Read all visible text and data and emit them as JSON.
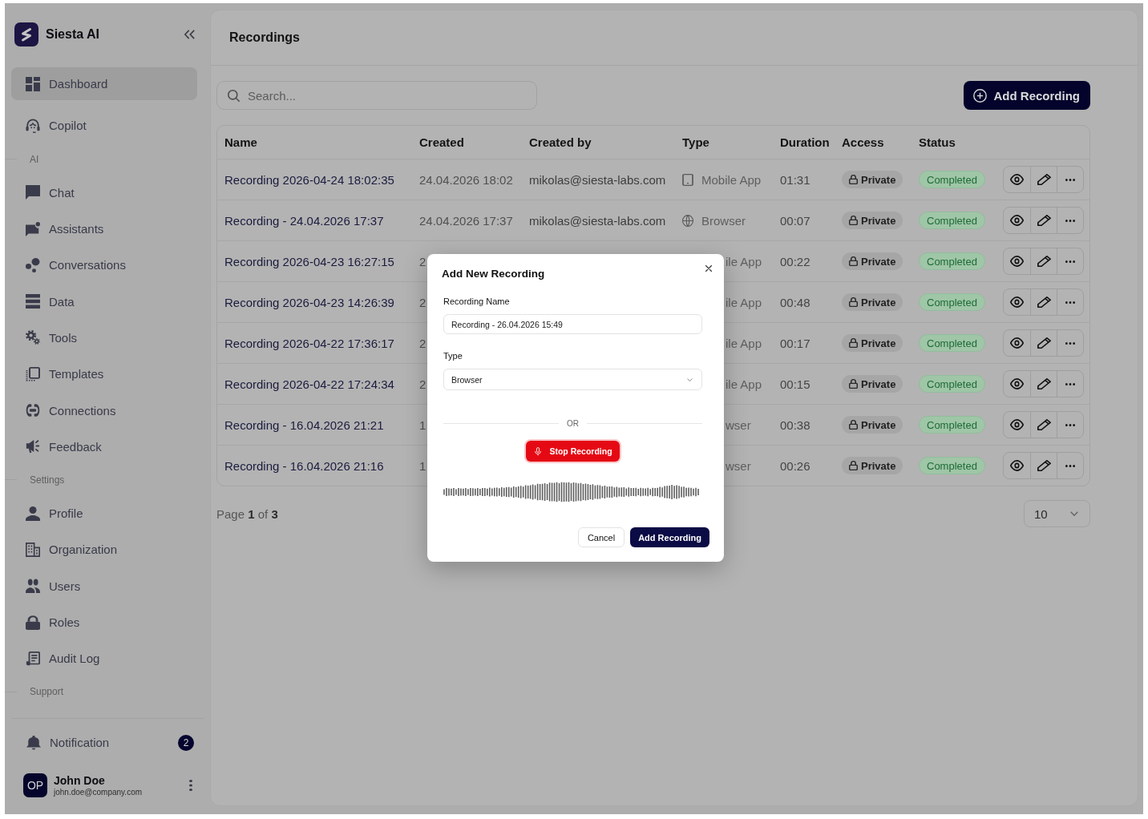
{
  "sidebar": {
    "brand": "Siesta AI",
    "nav": [
      {
        "kind": "link",
        "label": "Dashboard",
        "selected": true
      },
      {
        "kind": "link",
        "label": "Copilot",
        "selected": false
      },
      {
        "kind": "section",
        "label": "AI"
      },
      {
        "kind": "link",
        "label": "Chat",
        "selected": false
      },
      {
        "kind": "link",
        "label": "Assistants",
        "selected": false
      },
      {
        "kind": "link",
        "label": "Conversations",
        "selected": false
      },
      {
        "kind": "link",
        "label": "Data",
        "selected": false
      },
      {
        "kind": "link",
        "label": "Tools",
        "selected": false
      },
      {
        "kind": "link",
        "label": "Templates",
        "selected": false
      },
      {
        "kind": "link",
        "label": "Connections",
        "selected": false
      },
      {
        "kind": "link",
        "label": "Feedback",
        "selected": false
      },
      {
        "kind": "section",
        "label": "Settings"
      },
      {
        "kind": "link",
        "label": "Profile",
        "selected": false
      },
      {
        "kind": "link",
        "label": "Organization",
        "selected": false
      },
      {
        "kind": "link",
        "label": "Users",
        "selected": false
      },
      {
        "kind": "link",
        "label": "Roles",
        "selected": false
      },
      {
        "kind": "link",
        "label": "Audit Log",
        "selected": false
      },
      {
        "kind": "section",
        "label": "Support"
      }
    ],
    "notification": {
      "label": "Notification",
      "count": "2"
    },
    "user": {
      "initials": "OP",
      "name": "John Doe",
      "email": "john.doe@company.com"
    }
  },
  "header": {
    "title": "Recordings"
  },
  "toolbar": {
    "search": {
      "placeholder": "Search..."
    },
    "add_button": "Add Recording"
  },
  "table": {
    "columns": [
      "Name",
      "Created",
      "Created by",
      "Type",
      "Duration",
      "Access",
      "Status"
    ],
    "rows": [
      {
        "name": "Recording 2026-04-24 18:02:35",
        "created": "24.04.2026 18:02",
        "created_by": "mikolas@siesta-labs.com",
        "type": {
          "kind": "mobile",
          "label": "Mobile App"
        },
        "duration": "01:31",
        "access": "Private",
        "status": "Completed"
      },
      {
        "name": "Recording - 24.04.2026 17:37",
        "created": "24.04.2026 17:37",
        "created_by": "mikolas@siesta-labs.com",
        "type": {
          "kind": "browser",
          "label": "Browser"
        },
        "duration": "00:07",
        "access": "Private",
        "status": "Completed"
      },
      {
        "name": "Recording 2026-04-23 16:27:15",
        "created": "2",
        "type": {
          "kind": "cut",
          "label": "ile App"
        },
        "duration": "00:22",
        "access": "Private",
        "status": "Completed"
      },
      {
        "name": "Recording 2026-04-23 14:26:39",
        "created": "2",
        "type": {
          "kind": "cut",
          "label": "ile App"
        },
        "duration": "00:48",
        "access": "Private",
        "status": "Completed"
      },
      {
        "name": "Recording 2026-04-22 17:36:17",
        "created": "2",
        "type": {
          "kind": "cut",
          "label": "ile App"
        },
        "duration": "00:17",
        "access": "Private",
        "status": "Completed"
      },
      {
        "name": "Recording 2026-04-22 17:24:34",
        "created": "2",
        "type": {
          "kind": "cut",
          "label": "ile App"
        },
        "duration": "00:15",
        "access": "Private",
        "status": "Completed"
      },
      {
        "name": "Recording - 16.04.2026 21:21",
        "created": "1",
        "type": {
          "kind": "cut",
          "label": "wser"
        },
        "duration": "00:38",
        "access": "Private",
        "status": "Completed"
      },
      {
        "name": "Recording - 16.04.2026 21:16",
        "created": "1",
        "type": {
          "kind": "cut",
          "label": "wser"
        },
        "duration": "00:26",
        "access": "Private",
        "status": "Completed"
      }
    ]
  },
  "pagination": {
    "label": "Page **1** of **3**",
    "page_size": "10"
  },
  "dialog": {
    "title": "Add New Recording",
    "fields": [
      {
        "kind": "text",
        "label": "Recording Name",
        "value": "Recording - 26.04.2026 15:49"
      },
      {
        "kind": "select",
        "label": "Type",
        "value": "Browser"
      }
    ],
    "divider": "OR",
    "record_button": "Stop Recording",
    "buttons": [
      {
        "kind": "secondary",
        "label": "Cancel"
      },
      {
        "kind": "primary",
        "label": "Add Recording"
      }
    ]
  }
}
